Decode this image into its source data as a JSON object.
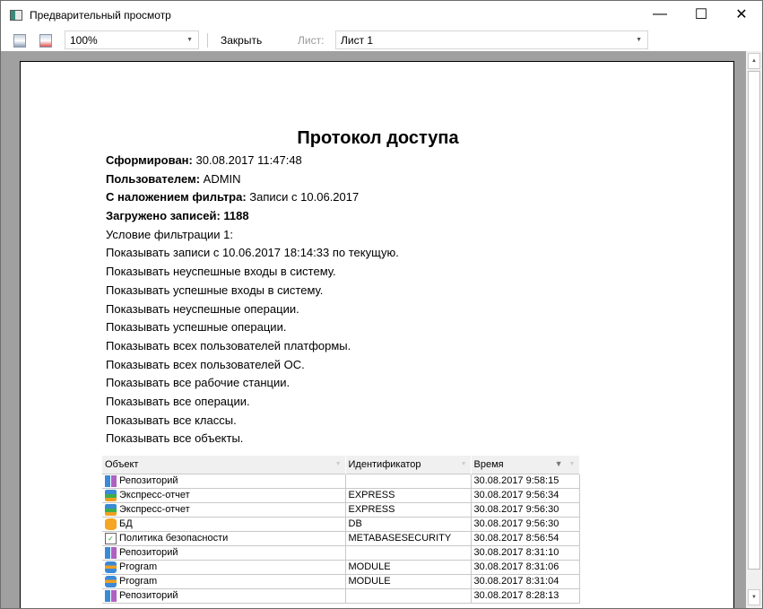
{
  "window": {
    "title": "Предварительный просмотр",
    "minimize": "—",
    "maximize": "☐",
    "close": "✕"
  },
  "toolbar": {
    "zoom": "100%",
    "close_label": "Закрыть",
    "sheet_label": "Лист:",
    "sheet_value": "Лист 1"
  },
  "report": {
    "title": "Протокол доступа",
    "meta": [
      {
        "label": "Сформирован:",
        "value": " 30.08.2017 11:47:48"
      },
      {
        "label": "Пользователем:",
        "value": " ADMIN"
      },
      {
        "label": "С наложением фильтра:",
        "value": " Записи с 10.06.2017"
      },
      {
        "label": "Загружено записей: 1188",
        "value": ""
      }
    ],
    "conditions": [
      "Условие фильтрации 1:",
      "Показывать записи с 10.06.2017 18:14:33 по текущую.",
      "Показывать неуспешные входы в систему.",
      "Показывать успешные входы в систему.",
      "Показывать неуспешные операции.",
      "Показывать успешные операции.",
      "Показывать всех пользователей платформы.",
      "Показывать всех пользователей ОС.",
      "Показывать все рабочие станции.",
      "Показывать все операции.",
      "Показывать все классы.",
      "Показывать все объекты."
    ]
  },
  "table": {
    "headers": [
      "Объект",
      "Идентификатор",
      "Время"
    ],
    "rows": [
      {
        "icon": "repo",
        "object": "Репозиторий",
        "id": "",
        "time": "30.08.2017 9:58:15"
      },
      {
        "icon": "cube",
        "object": "Экспресс-отчет",
        "id": "EXPRESS",
        "time": "30.08.2017 9:56:34"
      },
      {
        "icon": "cube",
        "object": "Экспресс-отчет",
        "id": "EXPRESS",
        "time": "30.08.2017 9:56:30"
      },
      {
        "icon": "db",
        "object": "БД",
        "id": "DB",
        "time": "30.08.2017 9:56:30"
      },
      {
        "icon": "pol",
        "object": "Политика безопасности",
        "id": "METABASESECURITY",
        "time": "30.08.2017 8:56:54"
      },
      {
        "icon": "repo",
        "object": "Репозиторий",
        "id": "",
        "time": "30.08.2017 8:31:10"
      },
      {
        "icon": "prog",
        "object": "Program",
        "id": "MODULE",
        "time": "30.08.2017 8:31:06"
      },
      {
        "icon": "prog",
        "object": "Program",
        "id": "MODULE",
        "time": "30.08.2017 8:31:04"
      },
      {
        "icon": "repo",
        "object": "Репозиторий",
        "id": "",
        "time": "30.08.2017 8:28:13"
      }
    ]
  }
}
